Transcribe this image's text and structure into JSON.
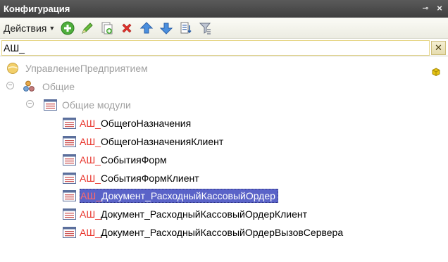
{
  "window": {
    "title": "Конфигурация"
  },
  "toolbar": {
    "actions_label": "Действия",
    "tools": [
      "add-icon",
      "edit-icon",
      "copy-icon",
      "delete-icon",
      "move-up-icon",
      "move-down-icon",
      "sort-icon",
      "filter-icon"
    ]
  },
  "filter": {
    "value": "АШ_",
    "clear_label": "✕"
  },
  "tree": {
    "root": {
      "label": "УправлениеПредприятием"
    },
    "common": {
      "label": "Общие",
      "expander": "−"
    },
    "common_modules": {
      "label": "Общие модули",
      "expander": "−"
    },
    "modules": [
      {
        "prefix": "АШ_",
        "name": "ОбщегоНазначения",
        "selected": false
      },
      {
        "prefix": "АШ_",
        "name": "ОбщегоНазначенияКлиент",
        "selected": false
      },
      {
        "prefix": "АШ_",
        "name": "СобытияФорм",
        "selected": false
      },
      {
        "prefix": "АШ_",
        "name": "СобытияФормКлиент",
        "selected": false
      },
      {
        "prefix": "АШ_",
        "name": "Документ_РасходныйКассовыйОрдер",
        "selected": true
      },
      {
        "prefix": "АШ_",
        "name": "Документ_РасходныйКассовыйОрдерКлиент",
        "selected": false
      },
      {
        "prefix": "АШ_",
        "name": "Документ_РасходныйКассовыйОрдерВызовСервера",
        "selected": false
      }
    ]
  },
  "colors": {
    "title_bg": "#4a4a4a",
    "prefix_red": "#e8332a",
    "selection": "#5a63c8"
  }
}
